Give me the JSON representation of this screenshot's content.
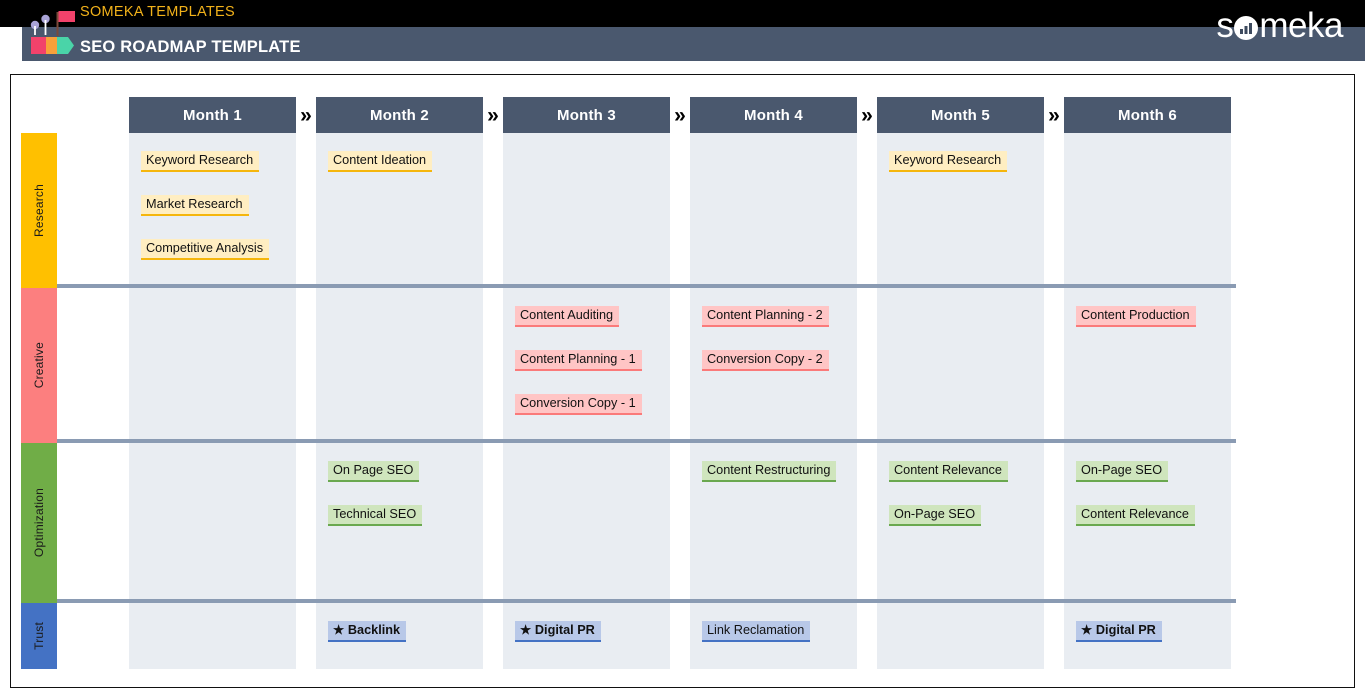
{
  "header": {
    "templates_label": "SOMEKA TEMPLATES",
    "title": "SEO ROADMAP TEMPLATE",
    "wordmark_before": "s",
    "wordmark_after": "meka",
    "topbar_color": "#000000",
    "brandbar_color": "#4a586e",
    "accent_color": "#f2b21a"
  },
  "roadmap": {
    "chevron_glyph": "»",
    "star_glyph": "★",
    "months": [
      {
        "label": "Month 1"
      },
      {
        "label": "Month 2"
      },
      {
        "label": "Month 3"
      },
      {
        "label": "Month 4"
      },
      {
        "label": "Month 5"
      },
      {
        "label": "Month 6"
      }
    ],
    "categories": [
      {
        "label": "Research",
        "color": "#ffc000"
      },
      {
        "label": "Creative",
        "color": "#fc7f7f"
      },
      {
        "label": "Optimization",
        "color": "#70ad47"
      },
      {
        "label": "Trust",
        "color": "#4472c4"
      }
    ],
    "tasks": {
      "research": {
        "month1": [
          "Keyword Research",
          "Market Research",
          "Competitive Analysis"
        ],
        "month2": [
          "Content Ideation"
        ],
        "month3": [],
        "month4": [],
        "month5": [
          "Keyword Research"
        ],
        "month6": []
      },
      "creative": {
        "month1": [],
        "month2": [],
        "month3": [
          "Content Auditing",
          "Content Planning - 1",
          "Conversion Copy - 1"
        ],
        "month4": [
          "Content Planning - 2",
          "Conversion Copy - 2"
        ],
        "month5": [],
        "month6": [
          "Content Production"
        ]
      },
      "optimization": {
        "month1": [],
        "month2": [
          "On Page SEO",
          "Technical SEO"
        ],
        "month3": [],
        "month4": [
          "Content Restructuring"
        ],
        "month5": [
          "Content Relevance",
          "On-Page SEO"
        ],
        "month6": [
          "On-Page SEO",
          "Content Relevance"
        ]
      },
      "trust": {
        "month1": [],
        "month2": [
          "★ Backlink"
        ],
        "month3": [
          "★ Digital PR"
        ],
        "month4": [
          "Link Reclamation"
        ],
        "month5": [],
        "month6": [
          "★ Digital PR"
        ]
      }
    }
  }
}
